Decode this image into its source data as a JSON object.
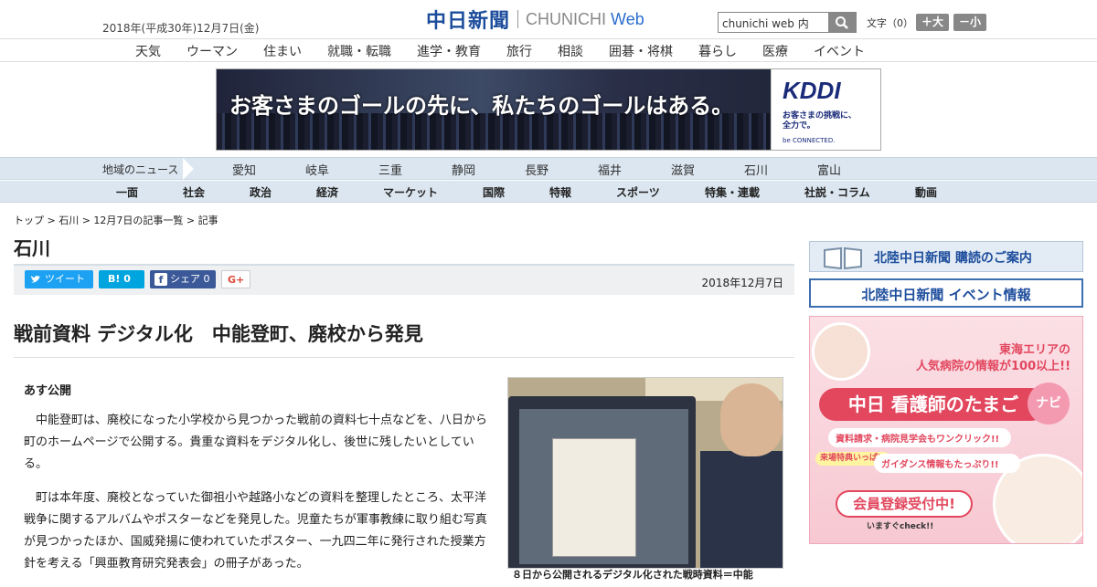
{
  "header": {
    "date": "2018年(平成30年)12月7日(金)",
    "logo_jp": "中日新聞",
    "logo_en": "CHUNICHI",
    "logo_web": "Web",
    "search_placeholder": "chunichi web 内",
    "font_size_label": "文字（0）",
    "font_larger": "＋大",
    "font_smaller": "－小"
  },
  "nav1": [
    "天気",
    "ウーマン",
    "住まい",
    "就職・転職",
    "進学・教育",
    "旅行",
    "相談",
    "囲碁・将棋",
    "暮らし",
    "医療",
    "イベント"
  ],
  "ad": {
    "message": "お客さまのゴールの先に、私たちのゴールはある。",
    "brand": "KDDI",
    "tagline1": "お客さまの挑戦に、",
    "tagline2": "全力で。",
    "sub": "be CONNECTED."
  },
  "regional": {
    "label": "地域のニュース",
    "items": [
      "愛知",
      "岐阜",
      "三重",
      "静岡",
      "長野",
      "福井",
      "滋賀",
      "石川",
      "富山"
    ]
  },
  "categories": [
    "一面",
    "社会",
    "政治",
    "経済",
    "マーケット",
    "国際",
    "特報",
    "スポーツ",
    "特集・連載",
    "社説・コラム",
    "動画"
  ],
  "breadcrumb": "トップ > 石川 > 12月7日の記事一覧 > 記事",
  "section_title": "石川",
  "share": {
    "tweet": "ツイート",
    "hatena": "B! 0",
    "facebook": "シェア 0",
    "gplus": "G+",
    "date": "2018年12月7日"
  },
  "article": {
    "title": "戦前資料 デジタル化　中能登町、廃校から発見",
    "lead": "あす公開",
    "paragraphs": [
      "　中能登町は、廃校になった小学校から見つかった戦前の資料七十点などを、八日から町のホームページで公開する。貴重な資料をデジタル化し、後世に残したいとしている。",
      "　町は本年度、廃校となっていた御祖小や越路小などの資料を整理したところ、太平洋戦争に関するアルバムやポスターなどを発見した。児童たちが軍事教練に取り組む写真が見つかったほか、国威発揚に使われていたポスター、一九四二年に発行された授業方針を考える「興亜教育研究発表会」の冊子があった。"
    ],
    "caption": "８日から公開されるデジタル化された戦時資料＝中能"
  },
  "sidebar": {
    "subscribe": "北陸中日新聞 購読のご案内",
    "events": "北陸中日新聞 イベント情報",
    "banner": {
      "line1": "東海エリアの",
      "line2": "人気病院の情報が100以上!!",
      "title": "中日 看護師のたまご",
      "navi": "ナビ",
      "feat1": "資料請求・病院見学会もワンクリック!!",
      "perk": "来場特典いっぱい",
      "feat2": "ガイダンス情報もたっぷり!!",
      "cta": "会員登録受付中!",
      "cta_sub": "いますぐcheck!!"
    }
  }
}
